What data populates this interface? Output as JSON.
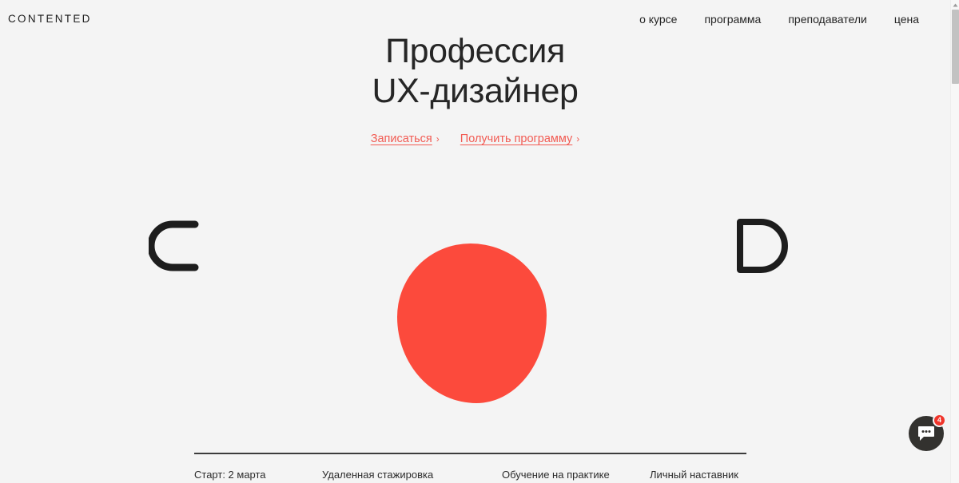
{
  "header": {
    "logo": "CONTENTED",
    "nav": [
      {
        "label": "о курсе"
      },
      {
        "label": "программа"
      },
      {
        "label": "преподаватели"
      },
      {
        "label": "цена"
      }
    ]
  },
  "hero": {
    "title": "Профессия\nUX-дизайнер",
    "actions": [
      {
        "label": "Записаться",
        "chevron": "›"
      },
      {
        "label": "Получить программу",
        "chevron": "›"
      }
    ]
  },
  "art": {
    "left_letter": "C",
    "right_letter": "D",
    "blob_color": "#fc4a3c",
    "letter_color": "#1d1d1d"
  },
  "features": [
    {
      "label": "Старт: 2 марта"
    },
    {
      "label": "Удаленная стажировка"
    },
    {
      "label": "Обучение на практике"
    },
    {
      "label": "Личный наставник"
    }
  ],
  "chat": {
    "badge_count": "4",
    "badge_color": "#f0352b",
    "button_color": "#33322f"
  },
  "theme": {
    "background": "#f4f4f4",
    "accent": "#f25b53",
    "text": "#242424"
  }
}
